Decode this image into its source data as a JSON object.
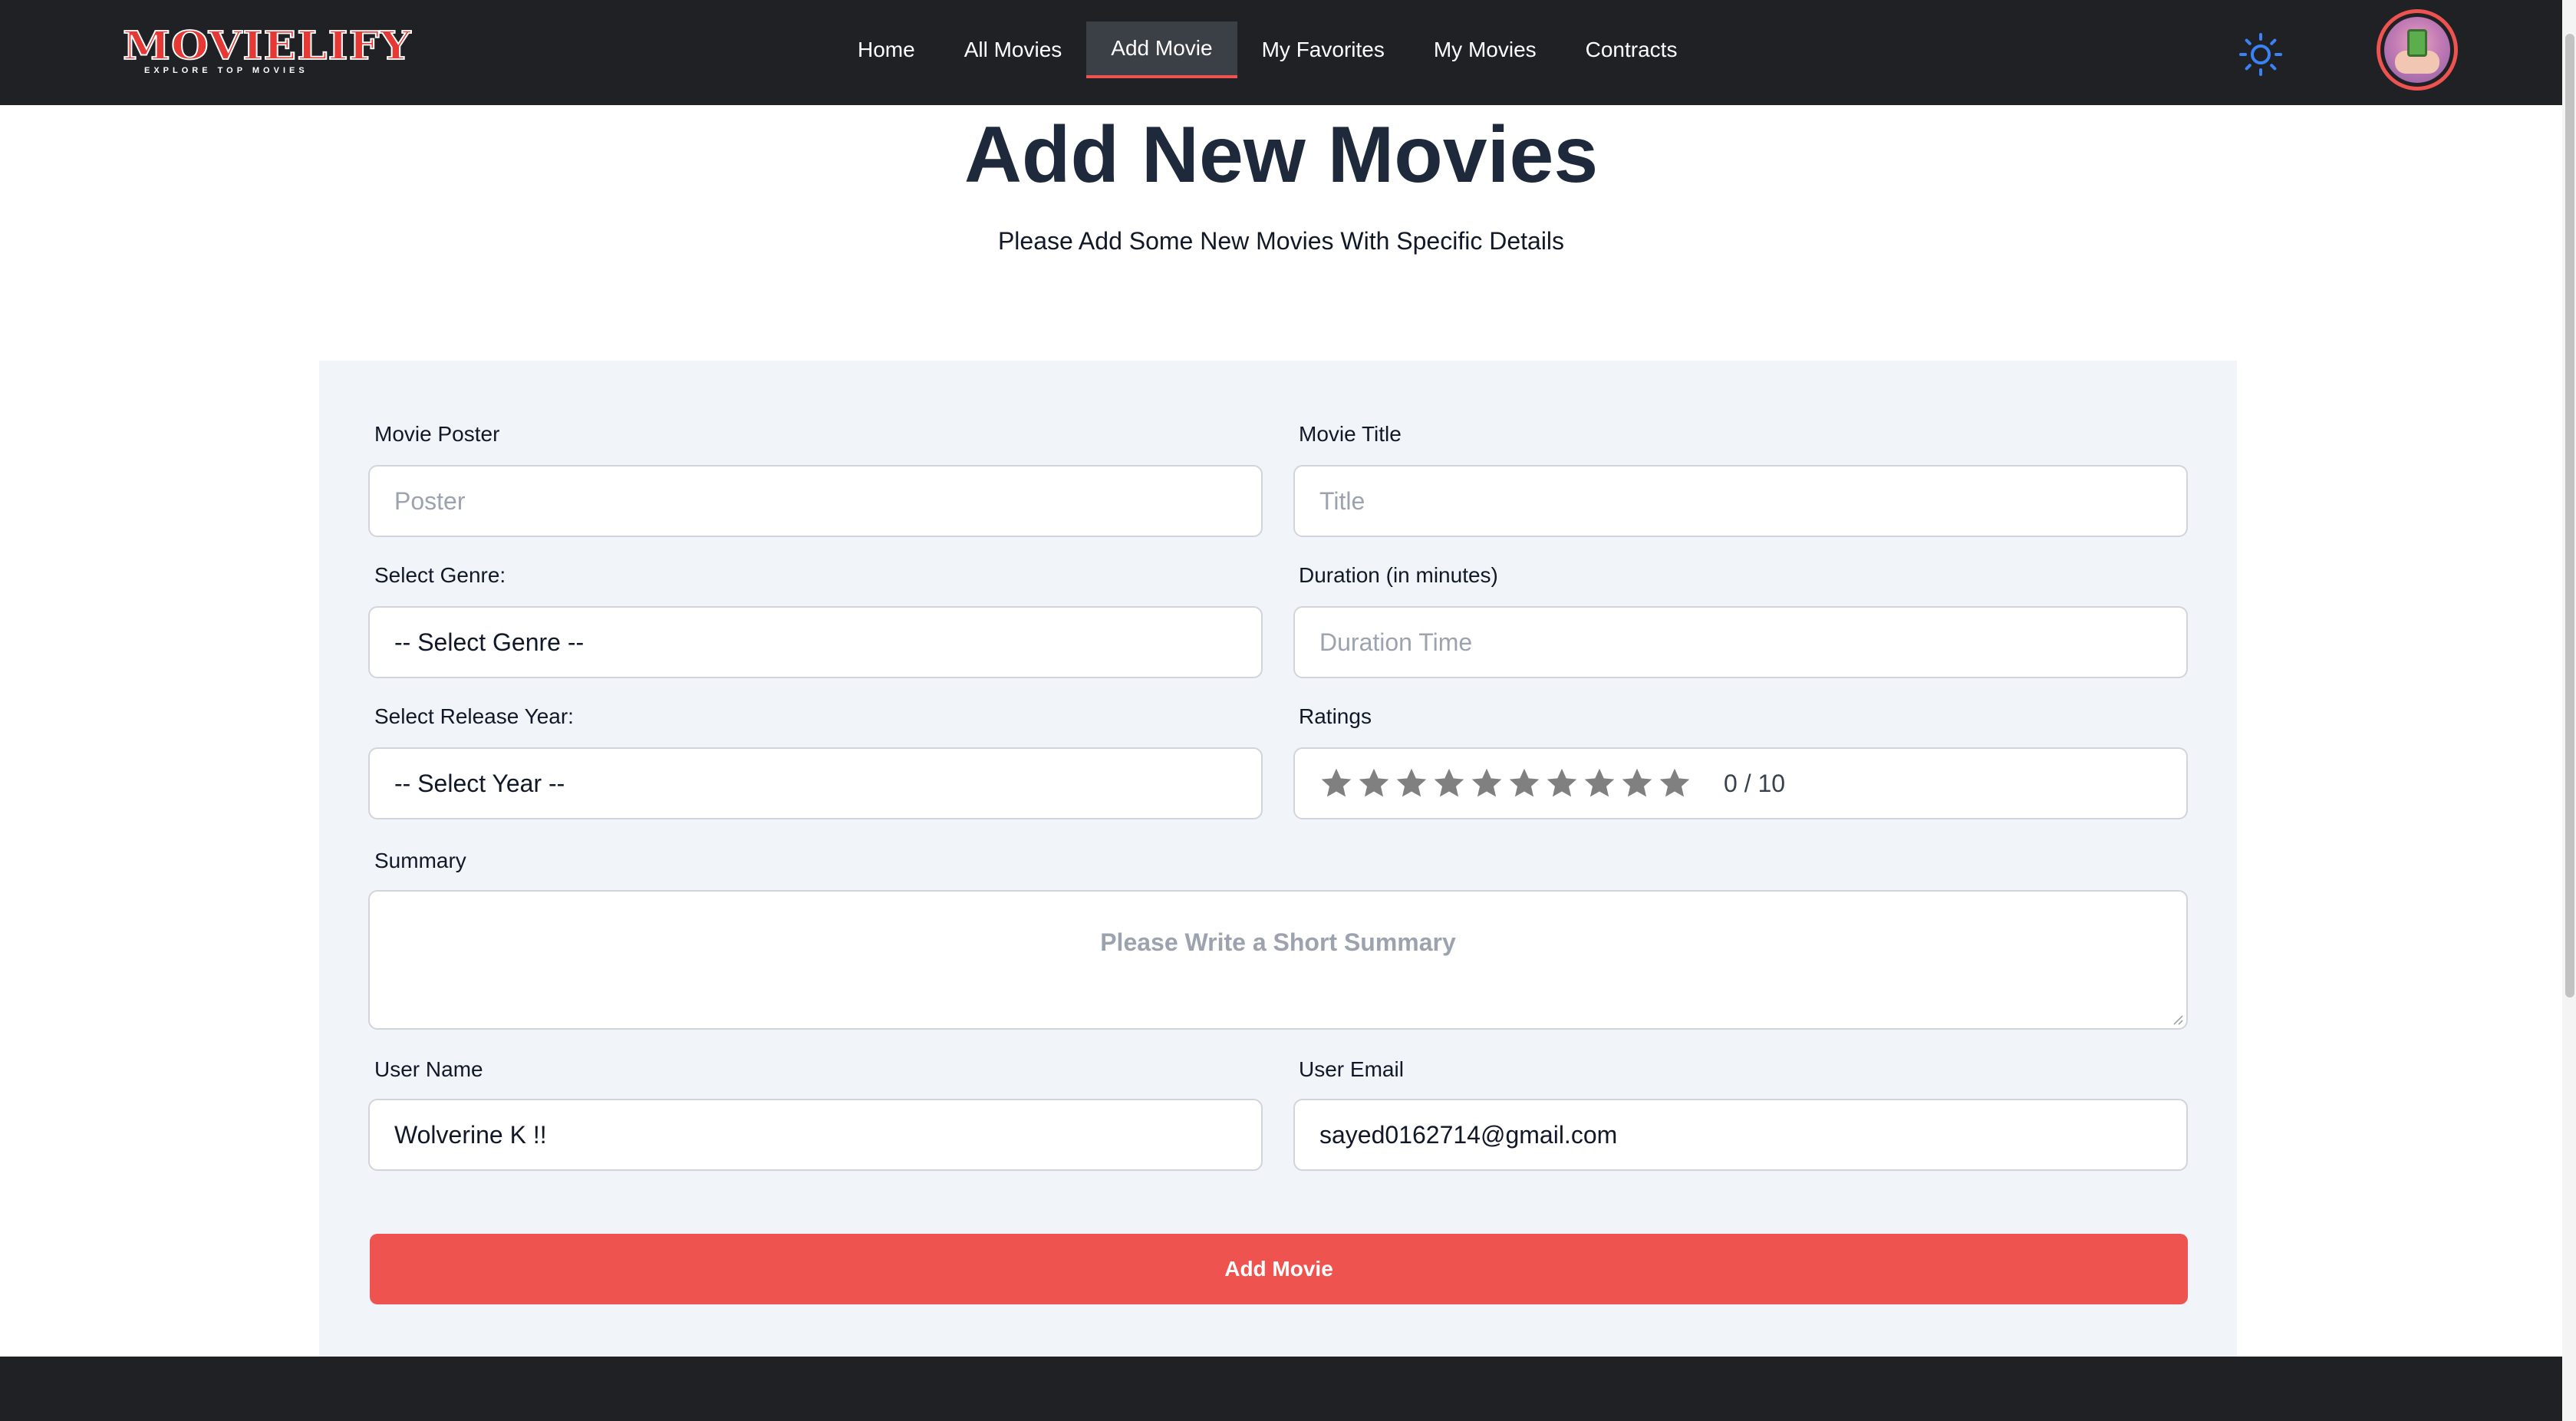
{
  "brand": {
    "logo_text": "MOVIELIFY",
    "tagline": "EXPLORE TOP MOVIES"
  },
  "nav": {
    "items": [
      {
        "label": "Home",
        "active": false
      },
      {
        "label": "All Movies",
        "active": false
      },
      {
        "label": "Add Movie",
        "active": true
      },
      {
        "label": "My Favorites",
        "active": false
      },
      {
        "label": "My Movies",
        "active": false
      },
      {
        "label": "Contracts",
        "active": false
      }
    ],
    "theme_icon": "sun-icon",
    "avatar_icon": "user-avatar"
  },
  "header": {
    "title": "Add New Movies",
    "subtitle": "Please Add Some New Movies With Specific Details"
  },
  "form": {
    "poster": {
      "label": "Movie Poster",
      "placeholder": "Poster",
      "value": ""
    },
    "title": {
      "label": "Movie Title",
      "placeholder": "Title",
      "value": ""
    },
    "genre": {
      "label": "Select Genre:",
      "selected": "-- Select Genre --"
    },
    "duration": {
      "label": "Duration (in minutes)",
      "placeholder": "Duration Time",
      "value": ""
    },
    "year": {
      "label": "Select Release Year:",
      "selected": "-- Select Year --"
    },
    "ratings": {
      "label": "Ratings",
      "value": 0,
      "max": 10,
      "display": "0 / 10"
    },
    "summary": {
      "label": "Summary",
      "placeholder": "Please Write a Short Summary"
    },
    "user_name": {
      "label": "User Name",
      "value": "Wolverine K !!"
    },
    "user_email": {
      "label": "User Email",
      "value": "sayed0162714@gmail.com"
    },
    "submit_label": "Add Movie"
  },
  "colors": {
    "navbar": "#1f2125",
    "accent": "#ef5350",
    "card": "#f1f4f8",
    "theme_icon": "#3b82f6",
    "star_empty": "#808080"
  }
}
